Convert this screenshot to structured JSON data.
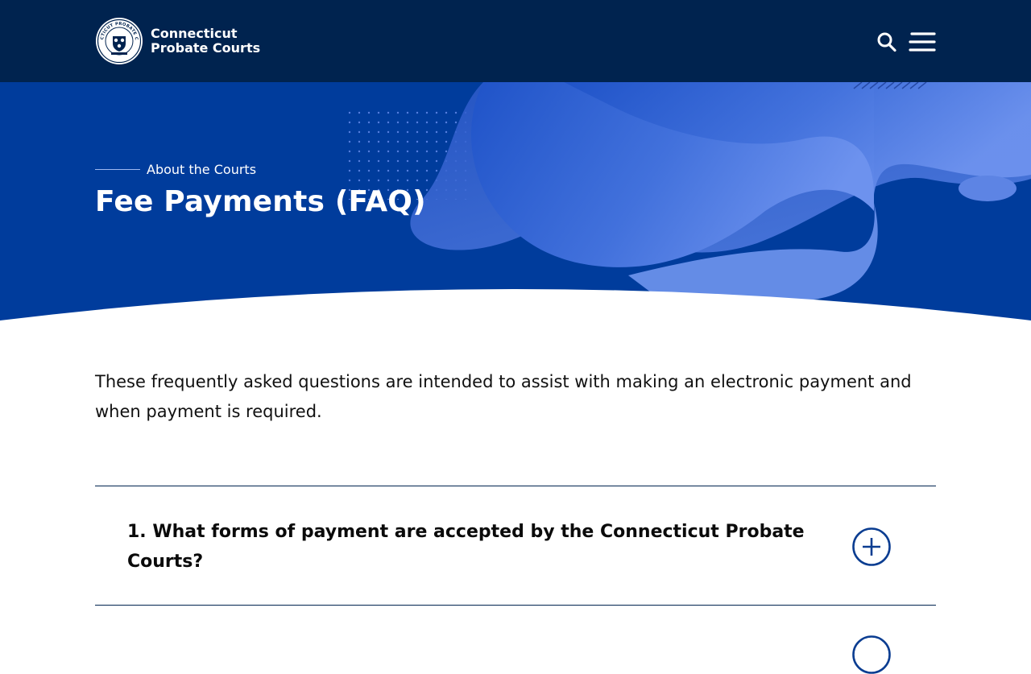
{
  "header": {
    "brand_line1": "Connecticut",
    "brand_line2": "Probate Courts",
    "seal_text": "CONNECTICUT PROBATE COURTS",
    "icons": [
      "search-icon",
      "menu-icon"
    ]
  },
  "hero": {
    "eyebrow": "About the Courts",
    "title": "Fee Payments (FAQ)"
  },
  "intro": "These frequently asked questions are intended to assist with making an electronic payment and when payment is required.",
  "faq": {
    "items": [
      {
        "question": "1. What forms of payment are accepted by the Connecticut Probate Courts?"
      }
    ]
  },
  "colors": {
    "header_bg": "#00234f",
    "hero_bg": "#003c9c",
    "accent": "#0b3d91"
  }
}
